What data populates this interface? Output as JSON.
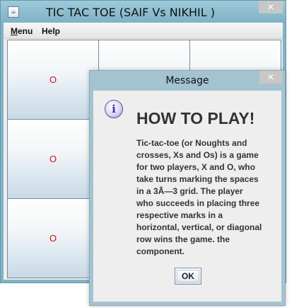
{
  "window": {
    "title": "TIC TAC TOE (SAIF Vs NIKHIL )",
    "close_glyph": "✕",
    "app_icon": "java-app-icon",
    "title_bar_color": "#7eb2c6"
  },
  "menubar": {
    "items": [
      {
        "label": "Menu"
      },
      {
        "label": "Help"
      }
    ]
  },
  "board": {
    "mark_color": "#cc1111",
    "cells": [
      "O",
      "",
      "",
      "O",
      "",
      "",
      "O",
      "",
      ""
    ]
  },
  "dialog": {
    "title": "Message",
    "close_glyph": "✕",
    "icon": "info-icon",
    "icon_glyph": "i",
    "heading": "HOW TO PLAY!",
    "body": "Tic-tac-toe (or Noughts and crosses, Xs and Os) is a game for two players, X and O, who take turns marking the spaces in a 3Ã—3 grid. The player who succeeds in placing three respective marks in a horizontal, vertical, or diagonal row wins the game. the component.",
    "ok_label": "OK"
  }
}
